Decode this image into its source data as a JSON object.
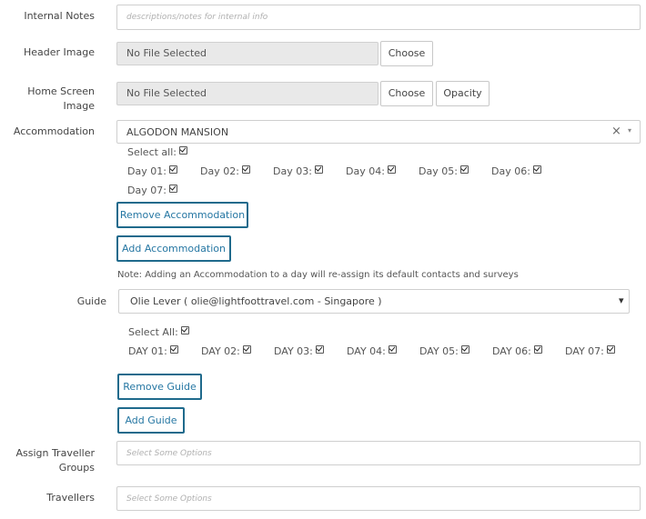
{
  "internal_notes": {
    "label": "Internal Notes",
    "placeholder": "descriptions/notes for internal info"
  },
  "header_image": {
    "label": "Header Image",
    "file_status": "No File Selected",
    "choose_label": "Choose"
  },
  "home_screen_image": {
    "label_line1": "Home Screen",
    "label_line2": "Image",
    "file_status": "No File Selected",
    "choose_label": "Choose",
    "opacity_label": "Opacity"
  },
  "accommodation": {
    "label": "Accommodation",
    "selected": "ALGODON MANSION",
    "clear_glyph": "×",
    "arrow_glyph": "▾",
    "select_all_label": "Select all:",
    "days": [
      "Day 01:",
      "Day 02:",
      "Day 03:",
      "Day 04:",
      "Day 05:",
      "Day 06:",
      "Day 07:"
    ],
    "remove_label": "Remove Accommodation",
    "add_label": "Add Accommodation",
    "note": "Note: Adding an Accommodation to a day will re-assign its default contacts and surveys"
  },
  "guide": {
    "label": "Guide",
    "selected": "Olie Lever ( olie@lightfoottravel.com - Singapore )",
    "arrow_glyph": "▾",
    "select_all_label": "Select All:",
    "days": [
      "DAY 01:",
      "DAY 02:",
      "DAY 03:",
      "DAY 04:",
      "DAY 05:",
      "DAY 06:",
      "DAY 07:"
    ],
    "remove_label": "Remove Guide",
    "add_label": "Add Guide"
  },
  "assign_traveller_groups": {
    "label_line1": "Assign Traveller",
    "label_line2": "Groups",
    "placeholder": "Select Some Options"
  },
  "travellers": {
    "label": "Travellers",
    "placeholder": "Select Some Options"
  }
}
